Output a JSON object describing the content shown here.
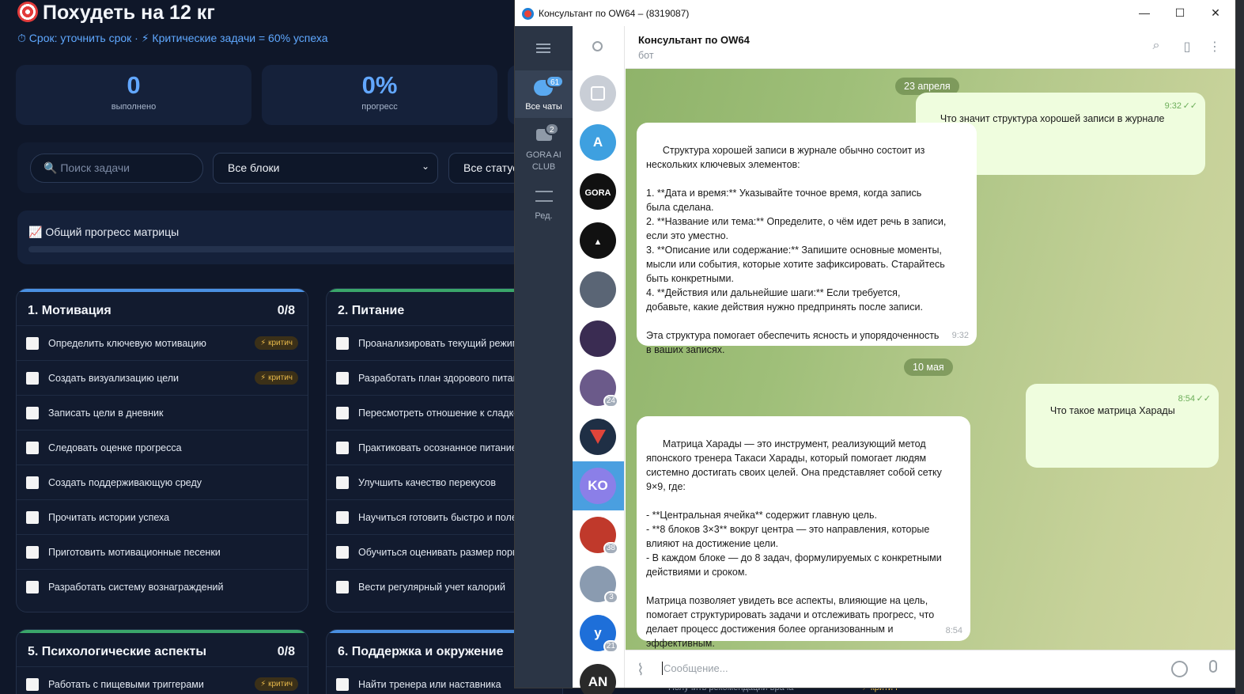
{
  "app": {
    "title": "Похудеть на 12 кг",
    "subtitle": "⏱ Срок: уточнить срок · ⚡ Критические задачи = 60% успеха",
    "stats": [
      {
        "value": "0",
        "label": "выполнено"
      },
      {
        "value": "0%",
        "label": "прогресс"
      }
    ],
    "search_placeholder": "🔍 Поиск задачи",
    "filter_blocks": "Все блоки",
    "filter_status": "Все статусы",
    "progress_title": "📈 Общий прогресс матрицы",
    "progress_fraction": 0,
    "critical_badge": "⚡ критич",
    "blocks": [
      {
        "title": "1. Мотивация",
        "count": "0/8",
        "accent": "#4a90e2",
        "tasks": [
          {
            "text": "Определить ключевую мотивацию",
            "critical": true
          },
          {
            "text": "Создать визуализацию цели",
            "critical": true
          },
          {
            "text": "Записать цели в дневник",
            "critical": false
          },
          {
            "text": "Следовать оценке прогресса",
            "critical": false
          },
          {
            "text": "Создать поддерживающую среду",
            "critical": false
          },
          {
            "text": "Прочитать истории успеха",
            "critical": false
          },
          {
            "text": "Приготовить мотивационные песенки",
            "critical": false
          },
          {
            "text": "Разработать систему вознаграждений",
            "critical": false
          }
        ]
      },
      {
        "title": "2. Питание",
        "count": "",
        "accent": "#3aa66a",
        "tasks": [
          {
            "text": "Проанализировать текущий режим питания",
            "critical": false
          },
          {
            "text": "Разработать план здорового питания",
            "critical": false
          },
          {
            "text": "Пересмотреть отношение к сладкому",
            "critical": false
          },
          {
            "text": "Практиковать осознанное питание",
            "critical": false
          },
          {
            "text": "Улучшить качество перекусов",
            "critical": false
          },
          {
            "text": "Научиться готовить быстро и полезно",
            "critical": false
          },
          {
            "text": "Обучиться оценивать размер порций",
            "critical": false
          },
          {
            "text": "Вести регулярный учет калорий",
            "critical": false
          }
        ]
      },
      {
        "title": "5. Психологические аспекты",
        "count": "0/8",
        "accent": "#3aa66a",
        "tasks": [
          {
            "text": "Работать с пищевыми триггерами",
            "critical": true
          }
        ]
      },
      {
        "title": "6. Поддержка и окружение",
        "count": "",
        "accent": "#4a90e2",
        "tasks": [
          {
            "text": "Найти тренера или наставника",
            "critical": false
          }
        ]
      }
    ],
    "bottom_peek": [
      "Получить рекомендации врача",
      "⚡ критич"
    ]
  },
  "telegram": {
    "window_title": "Консультант по OW64 – (8319087)",
    "folders": [
      {
        "label": "Все чаты",
        "badge": "61",
        "icon": "chats-icon"
      },
      {
        "label": "GORA AI CLUB",
        "badge": "2",
        "icon": "folder-icon"
      },
      {
        "label": "Ред.",
        "badge": "",
        "icon": "edit-icon"
      }
    ],
    "chats": [
      {
        "initials": "",
        "color": "#c9ced6",
        "badge": "",
        "kind": "archive"
      },
      {
        "initials": "A",
        "color": "#3ea0e0",
        "badge": "",
        "kind": "letter"
      },
      {
        "initials": "GORA",
        "color": "#111111",
        "badge": "",
        "kind": "logo"
      },
      {
        "initials": "▲",
        "color": "#111111",
        "badge": "",
        "kind": "logo"
      },
      {
        "initials": "",
        "color": "#5a6575",
        "badge": "",
        "kind": "photo"
      },
      {
        "initials": "",
        "color": "#3a2c52",
        "badge": "",
        "kind": "photo"
      },
      {
        "initials": "",
        "color": "#6b5a8a",
        "badge": "24",
        "kind": "photo"
      },
      {
        "initials": "",
        "color": "#1f2f45",
        "badge": "",
        "kind": "logo-red"
      },
      {
        "initials": "KO",
        "color": "#8b7fe8",
        "badge": "",
        "kind": "letter",
        "active": true
      },
      {
        "initials": "",
        "color": "#c0392b",
        "badge": "38",
        "kind": "photo"
      },
      {
        "initials": "",
        "color": "#8a9bb0",
        "badge": "3",
        "kind": "photo"
      },
      {
        "initials": "у",
        "color": "#1e6fd9",
        "badge": "21",
        "kind": "letter"
      },
      {
        "initials": "AN",
        "color": "#2a2a2a",
        "badge": "",
        "kind": "letter"
      }
    ],
    "chat": {
      "name": "Консультант по OW64",
      "status": "бот",
      "input_placeholder": "Сообщение..."
    },
    "messages": [
      {
        "type": "date",
        "text": "23 апреля"
      },
      {
        "type": "out",
        "text": "Что значит структура хорошей записи в журнале",
        "time": "9:32"
      },
      {
        "type": "in",
        "text": "Структура хорошей записи в журнале обычно состоит из\nнескольких ключевых элементов:\n\n1. **Дата и время:** Указывайте точное время, когда запись\nбыла сделана.\n2. **Название или тема:** Определите, о чём идет речь в записи,\nесли это уместно.\n3. **Описание или содержание:** Запишите основные моменты,\nмысли или события, которые хотите зафиксировать. Старайтесь\nбыть конкретными.\n4. **Действия или дальнейшие шаги:** Если требуется,\nдобавьте, какие действия нужно предпринять после записи.\n\nЭта структура помогает обеспечить ясность и упорядоченность\nв ваших записях.",
        "time": "9:32"
      },
      {
        "type": "date",
        "text": "10 мая"
      },
      {
        "type": "out",
        "text": "Что такое матрица Харады",
        "time": "8:54"
      },
      {
        "type": "in",
        "text": "Матрица Харады — это инструмент, реализующий метод\nяпонского тренера Такаси Харады, который помогает людям\nсистемно достигать своих целей. Она представляет собой сетку\n9×9, где:\n\n- **Центральная ячейка** содержит главную цель.\n- **8 блоков 3×3** вокруг центра — это направления, которые\nвлияют на достижение цели.\n- В каждом блоке — до 8 задач, формулируемых с конкретными\nдействиями и сроком.\n\nМатрица позволяет увидеть все аспекты, влияющие на цель,\nпомогает структурировать задачи и отслеживать прогресс, что\nделает процесс достижения более организованным и\nэффективным.",
        "time": "8:54"
      }
    ]
  }
}
